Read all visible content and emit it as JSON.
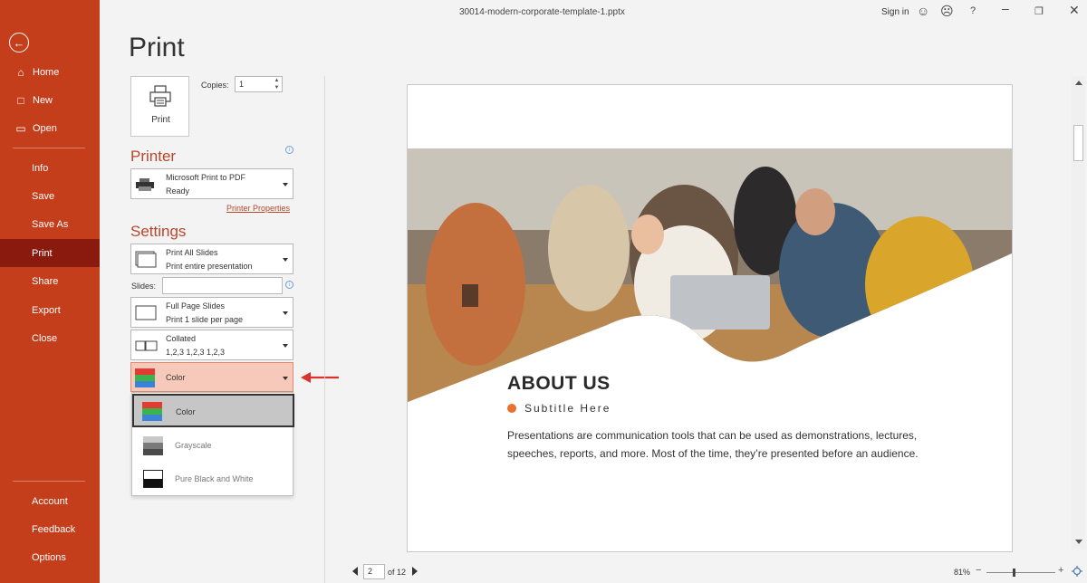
{
  "window": {
    "doc_title": "30014-modern-corporate-template-1.pptx",
    "sign_in": "Sign in",
    "help": "?"
  },
  "sidebar": {
    "items": [
      {
        "label": "Home",
        "icon": "home-icon"
      },
      {
        "label": "New",
        "icon": "new-doc-icon"
      },
      {
        "label": "Open",
        "icon": "folder-icon"
      },
      {
        "label": "Info"
      },
      {
        "label": "Save"
      },
      {
        "label": "Save As"
      },
      {
        "label": "Print",
        "active": true
      },
      {
        "label": "Share"
      },
      {
        "label": "Export"
      },
      {
        "label": "Close"
      },
      {
        "label": "Account"
      },
      {
        "label": "Feedback"
      },
      {
        "label": "Options"
      }
    ]
  },
  "page_title": "Print",
  "print_panel": {
    "print_button": "Print",
    "copies_label": "Copies:",
    "copies_value": "1",
    "printer_heading": "Printer",
    "printer_name": "Microsoft Print to PDF",
    "printer_status": "Ready",
    "printer_properties": "Printer Properties",
    "settings_heading": "Settings",
    "print_range": {
      "line1": "Print All Slides",
      "line2": "Print entire presentation"
    },
    "slides_label": "Slides:",
    "slides_value": "",
    "layout": {
      "line1": "Full Page Slides",
      "line2": "Print 1 slide per page"
    },
    "collation": {
      "line1": "Collated",
      "line2": "1,2,3    1,2,3    1,2,3"
    },
    "color_selected": "Color",
    "color_options": [
      "Color",
      "Grayscale",
      "Pure Black and White"
    ]
  },
  "preview": {
    "heading": "ABOUT US",
    "subtitle": "Subtitle Here",
    "body": "Presentations are communication tools that can be used as demonstrations, lectures, speeches, reports, and more. Most of the time, they’re presented before an audience.",
    "accent_color": "#e9722e"
  },
  "pagination": {
    "current_page": "2",
    "of_label": "of 12"
  },
  "zoom": {
    "level": "81%",
    "minus": "−",
    "plus": "+"
  },
  "colors": {
    "sidebar": "#c43e1c",
    "sidebar_active": "#8b1a0e",
    "heading": "#b7472a",
    "highlight": "#f7c9bb"
  }
}
